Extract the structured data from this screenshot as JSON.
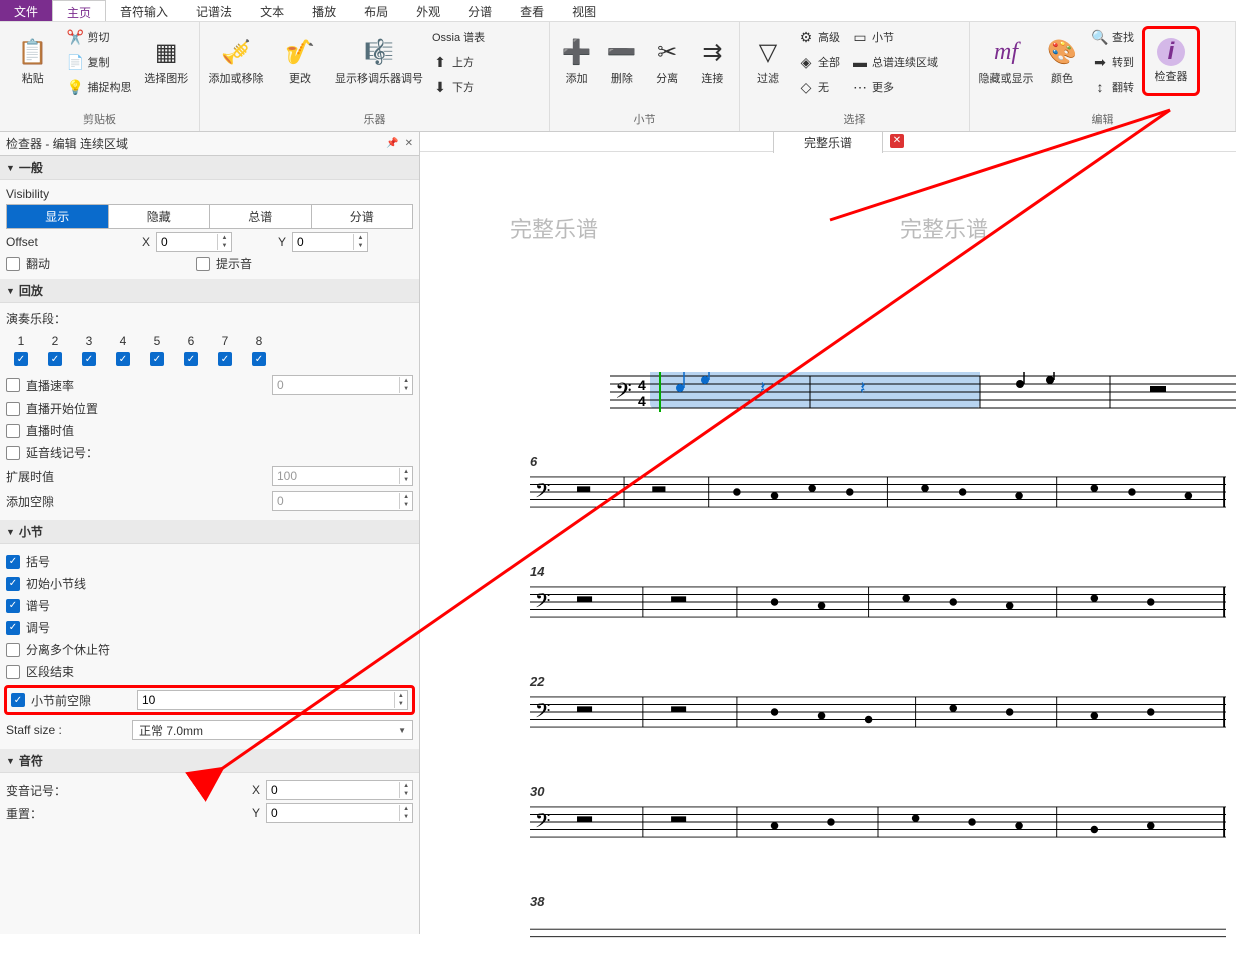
{
  "menubar": {
    "file": "文件",
    "tabs": [
      "主页",
      "音符输入",
      "记谱法",
      "文本",
      "播放",
      "布局",
      "外观",
      "分谱",
      "查看",
      "视图"
    ],
    "active_index": 0
  },
  "ribbon": {
    "clipboard": {
      "label": "剪贴板",
      "paste": "粘贴",
      "cut": "剪切",
      "copy": "复制",
      "capture": "捕捉构思",
      "select_graphic": "选择图形"
    },
    "instruments": {
      "label": "乐器",
      "add_remove": "添加或移除",
      "change": "更改",
      "transpose": "显示移调乐器调号",
      "ossia": "Ossia 谱表",
      "above": "上方",
      "below": "下方"
    },
    "bars": {
      "label": "小节",
      "add": "添加",
      "delete": "删除",
      "split": "分离",
      "join": "连接"
    },
    "select": {
      "label": "选择",
      "filter": "过滤",
      "advanced": "高级",
      "all": "全部",
      "none": "无",
      "bar": "小节",
      "continuous": "总谱连续区域",
      "more": "更多"
    },
    "edit": {
      "label": "编辑",
      "hide_show": "隐藏或显示",
      "color": "颜色",
      "find": "查找",
      "goto": "转到",
      "flip": "翻转",
      "inspector": "检查器"
    }
  },
  "inspector": {
    "title": "检查器 - 编辑 连续区域",
    "sections": {
      "general": {
        "header": "一般",
        "visibility_label": "Visibility",
        "vis_show": "显示",
        "vis_hide": "隐藏",
        "vis_score": "总谱",
        "vis_parts": "分谱",
        "offset_label": "Offset",
        "x_label": "X",
        "y_label": "Y",
        "x_val": "0",
        "y_val": "0",
        "flip": "翻动",
        "cue": "提示音"
      },
      "playback": {
        "header": "回放",
        "seg_label": "演奏乐段：",
        "segs": [
          "1",
          "2",
          "3",
          "4",
          "5",
          "6",
          "7",
          "8"
        ],
        "live_tempo": "直播速率",
        "live_tempo_val": "0",
        "live_start": "直播开始位置",
        "live_dur": "直播时值",
        "tie": "延音线记号：",
        "extend": "扩展时值",
        "extend_val": "100",
        "gap": "添加空隙",
        "gap_val": "0"
      },
      "bars": {
        "header": "小节",
        "brackets": "括号",
        "initial_barline": "初始小节线",
        "clef": "谱号",
        "key": "调号",
        "split_multirest": "分离多个休止符",
        "section_end": "区段结束",
        "gap_before": "小节前空隙",
        "gap_before_val": "10",
        "staff_size_label": "Staff size :",
        "staff_size_val": "正常 7.0mm"
      },
      "notes": {
        "header": "音符",
        "accidental": "变音记号：",
        "x_label": "X",
        "x_val": "0",
        "reset": "重置：",
        "y_label": "Y",
        "y_val": "0"
      }
    }
  },
  "score": {
    "tab_name": "完整乐谱",
    "title_left": "完整乐谱",
    "title_right": "完整乐谱",
    "bar_nums": [
      "6",
      "14",
      "22",
      "30",
      "38"
    ]
  }
}
